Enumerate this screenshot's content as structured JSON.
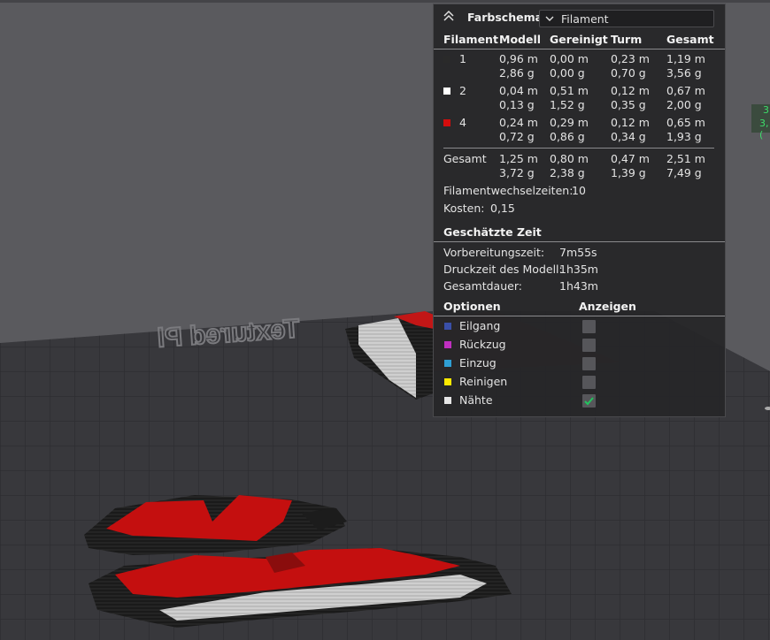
{
  "panel": {
    "title": "Farbschema",
    "scheme_value": "Filament",
    "headers": [
      "Filament",
      "Modell",
      "Gereinigt",
      "Turm",
      "Gesamt"
    ],
    "rows": [
      {
        "id": "1",
        "color": "#2a2a2a",
        "modell": [
          "0,96 m",
          "2,86 g"
        ],
        "gereinigt": [
          "0,00 m",
          "0,00 g"
        ],
        "turm": [
          "0,23 m",
          "0,70 g"
        ],
        "gesamt": [
          "1,19 m",
          "3,56 g"
        ]
      },
      {
        "id": "2",
        "color": "#ffffff",
        "modell": [
          "0,04 m",
          "0,13 g"
        ],
        "gereinigt": [
          "0,51 m",
          "1,52 g"
        ],
        "turm": [
          "0,12 m",
          "0,35 g"
        ],
        "gesamt": [
          "0,67 m",
          "2,00 g"
        ]
      },
      {
        "id": "4",
        "color": "#d40d0d",
        "modell": [
          "0,24 m",
          "0,72 g"
        ],
        "gereinigt": [
          "0,29 m",
          "0,86 g"
        ],
        "turm": [
          "0,12 m",
          "0,34 g"
        ],
        "gesamt": [
          "0,65 m",
          "1,93 g"
        ]
      }
    ],
    "total": {
      "label": "Gesamt",
      "modell": [
        "1,25 m",
        "3,72 g"
      ],
      "gereinigt": [
        "0,80 m",
        "2,38 g"
      ],
      "turm": [
        "0,47 m",
        "1,39 g"
      ],
      "gesamt": [
        "2,51 m",
        "7,49 g"
      ]
    },
    "filament_changes_label": "Filamentwechselzeiten:",
    "filament_changes_value": "10",
    "cost_label": "Kosten:",
    "cost_value": "0,15",
    "time_section_title": "Geschätzte Zeit",
    "times": [
      {
        "label": "Vorbereitungszeit:",
        "value": "7m55s"
      },
      {
        "label": "Druckzeit des Modell:",
        "value": "1h35m"
      },
      {
        "label": "Gesamtdauer:",
        "value": "1h43m"
      }
    ],
    "options_header": "Optionen",
    "show_header": "Anzeigen",
    "options": [
      {
        "label": "Eilgang",
        "color": "#3a4fa8",
        "checked": false
      },
      {
        "label": "Rückzug",
        "color": "#c02fc0",
        "checked": false
      },
      {
        "label": "Einzug",
        "color": "#2f9fd4",
        "checked": false
      },
      {
        "label": "Reinigen",
        "color": "#ffea00",
        "checked": false
      },
      {
        "label": "Nähte",
        "color": "#e6e6e6",
        "checked": true
      }
    ]
  },
  "side_indicator": {
    "line1": "3",
    "line2": "3,("
  },
  "bed_text": "Textured Pl",
  "colors": {
    "bed": "#36363a",
    "background": "#5a5a5e",
    "accent_green": "#3ddc6a"
  }
}
